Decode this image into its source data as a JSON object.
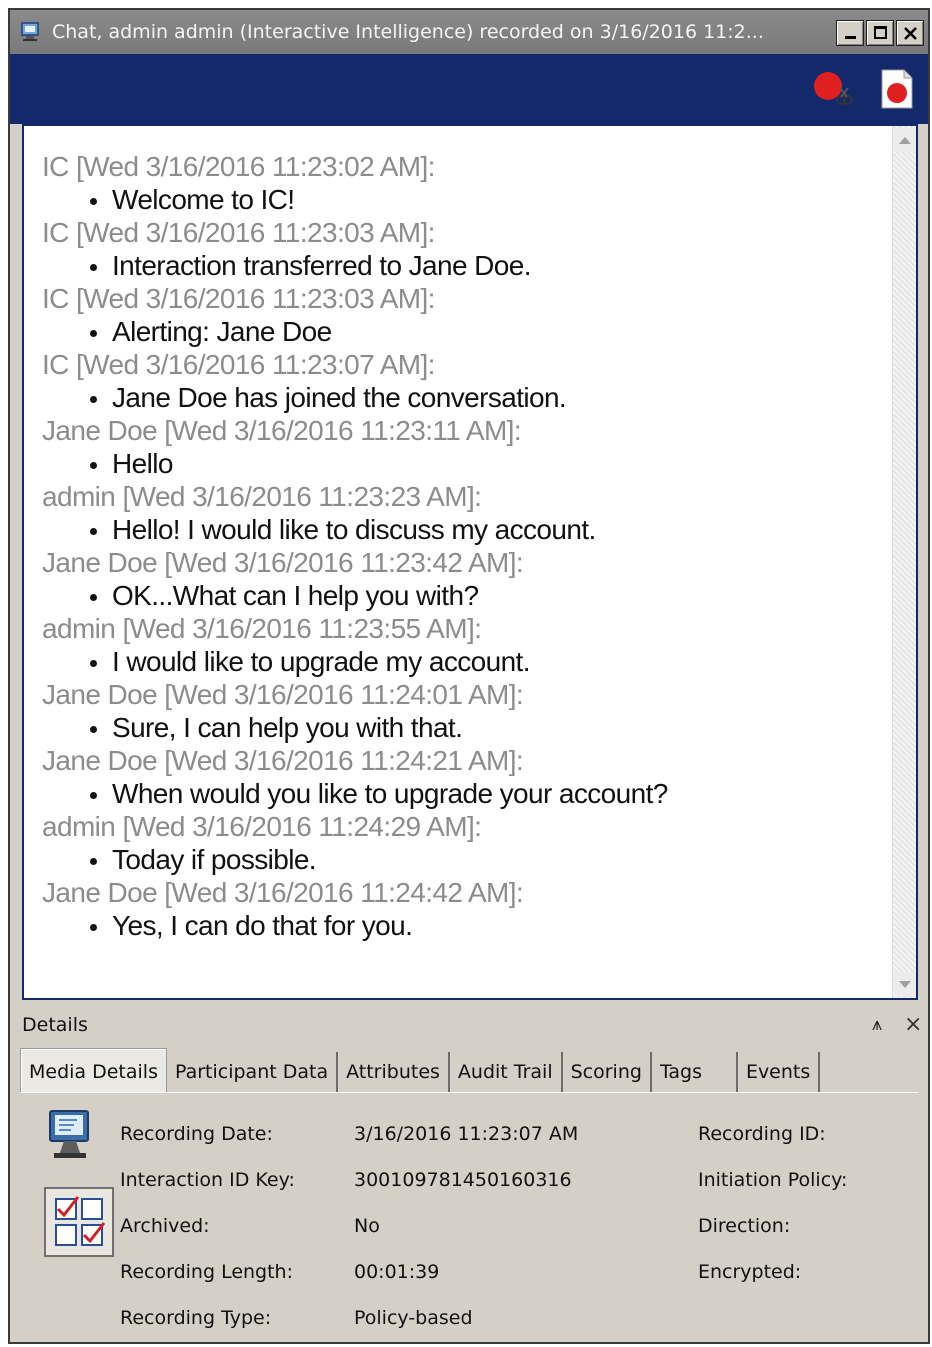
{
  "window": {
    "title": "Chat, admin admin (Interactive Intelligence) recorded on 3/16/2016 11:2...",
    "minimize_glyph": "_",
    "maximize_glyph": "□",
    "close_glyph": "X"
  },
  "toolbar": {
    "snip_icon": "record-snip-icon",
    "record_icon": "record-document-icon"
  },
  "transcript": [
    {
      "header": "IC [Wed 3/16/2016 11:23:02 AM]:",
      "text": "Welcome to IC!"
    },
    {
      "header": "IC [Wed 3/16/2016 11:23:03 AM]:",
      "text": "Interaction transferred to Jane Doe."
    },
    {
      "header": "IC [Wed 3/16/2016 11:23:03 AM]:",
      "text": "Alerting: Jane Doe"
    },
    {
      "header": "IC [Wed 3/16/2016 11:23:07 AM]:",
      "text": "Jane Doe has joined the conversation."
    },
    {
      "header": "Jane Doe [Wed 3/16/2016 11:23:11 AM]:",
      "text": "Hello"
    },
    {
      "header": "admin [Wed 3/16/2016 11:23:23 AM]:",
      "text": "Hello! I would like to discuss my account."
    },
    {
      "header": "Jane Doe [Wed 3/16/2016 11:23:42 AM]:",
      "text": "OK...What can I help you with?"
    },
    {
      "header": "admin [Wed 3/16/2016 11:23:55 AM]:",
      "text": "I would like to upgrade my account."
    },
    {
      "header": "Jane Doe [Wed 3/16/2016 11:24:01 AM]:",
      "text": "Sure, I can help you with that."
    },
    {
      "header": "Jane Doe [Wed 3/16/2016 11:24:21 AM]:",
      "text": "When would you like to upgrade your account?"
    },
    {
      "header": "admin [Wed 3/16/2016 11:24:29 AM]:",
      "text": "Today if possible."
    },
    {
      "header": "Jane Doe [Wed 3/16/2016 11:24:42 AM]:",
      "text": "Yes, I can do that for you."
    }
  ],
  "details": {
    "label": "Details",
    "pin_glyph": "⩚",
    "close_glyph": "×",
    "tabs": [
      "Media Details",
      "Participant Data",
      "Attributes",
      "Audit Trail",
      "Scoring",
      "Tags",
      "Events"
    ],
    "active_tab": "Media Details",
    "fields": [
      {
        "label": "Recording Date:",
        "value": "3/16/2016 11:23:07 AM"
      },
      {
        "label": "Interaction ID Key:",
        "value": "300109781450160316"
      },
      {
        "label": "Archived:",
        "value": "No"
      },
      {
        "label": "Recording Length:",
        "value": "00:01:39"
      },
      {
        "label": "Recording Type:",
        "value": "Policy-based"
      }
    ],
    "right_fields": [
      "Recording ID:",
      "Initiation Policy:",
      "Direction:",
      "Encrypted:"
    ]
  }
}
